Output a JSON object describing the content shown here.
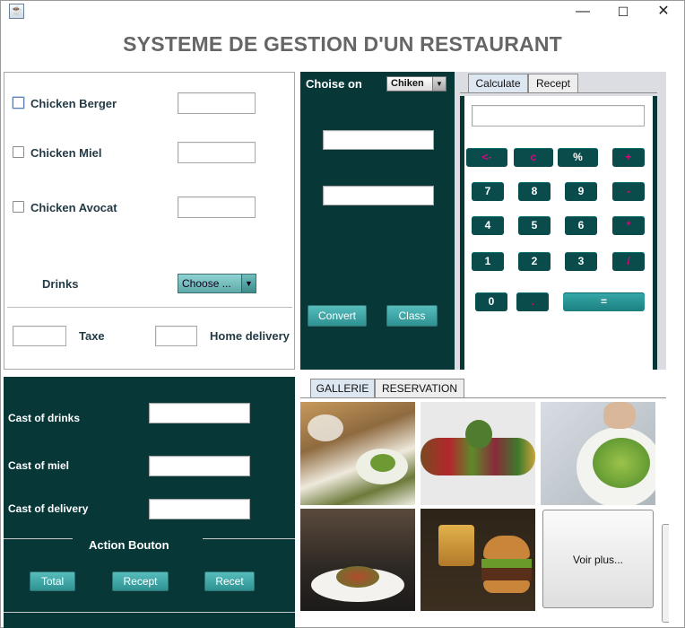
{
  "window": {
    "icon": "java-icon",
    "minimize": "—",
    "maximize": "☐",
    "close": "✕"
  },
  "app_title": "SYSTEME DE GESTION D'UN RESTAURANT",
  "menu": {
    "items": [
      {
        "label": "Chicken Berger",
        "value": ""
      },
      {
        "label": "Chicken Miel",
        "value": ""
      },
      {
        "label": "Chicken Avocat",
        "value": ""
      }
    ],
    "drinks_label": "Drinks",
    "drinks_select": "Choose ...",
    "taxe_label": "Taxe",
    "home_delivery_label": "Home delivery"
  },
  "converter": {
    "label": "Choise on",
    "select": "Chiken",
    "convert_button": "Convert",
    "class_button": "Class"
  },
  "calculator": {
    "tabs": [
      "Calculate",
      "Recept"
    ],
    "display": "",
    "rows": [
      [
        "<-",
        "c",
        "%",
        "+"
      ],
      [
        "7",
        "8",
        "9",
        "-"
      ],
      [
        "4",
        "5",
        "6",
        "*"
      ],
      [
        "1",
        "2",
        "3",
        "/"
      ],
      [
        "0",
        ".",
        "="
      ]
    ]
  },
  "costs": {
    "drinks_label": "Cast of drinks",
    "miel_label": "Cast of miel",
    "delivery_label": "Cast of delivery",
    "section_title": "Action Bouton",
    "total_button": "Total",
    "recept_button": "Recept",
    "recet_button": "Recet"
  },
  "gallery": {
    "tabs": [
      "GALLERIE",
      "RESERVATION"
    ],
    "more_button": "Voir plus..."
  }
}
